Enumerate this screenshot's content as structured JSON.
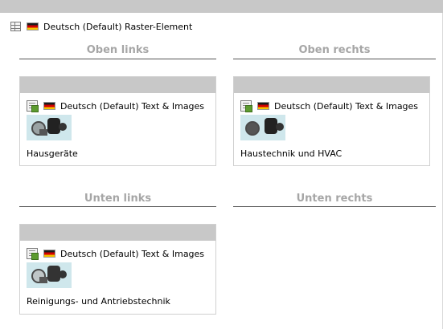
{
  "header": {
    "label": "Deutsch (Default) Raster-Element"
  },
  "columns": {
    "top_left": "Oben links",
    "top_right": "Oben rechts",
    "bottom_left": "Unten links",
    "bottom_right": "Unten rechts"
  },
  "elements": [
    {
      "label": "Deutsch (Default) Text & Images",
      "caption": "Hausgeräte"
    },
    {
      "label": "Deutsch (Default) Text & Images",
      "caption": "Haustechnik und HVAC"
    },
    {
      "label": "Deutsch (Default) Text & Images",
      "caption": "Reinigungs- und Antriebstechnik"
    }
  ],
  "icons": {
    "grid": "grid-element-icon",
    "flag": "german-flag-icon",
    "content": "text-images-icon"
  },
  "colors": {
    "bar": "#c8c8c8",
    "column_title": "#a6a6a6"
  }
}
